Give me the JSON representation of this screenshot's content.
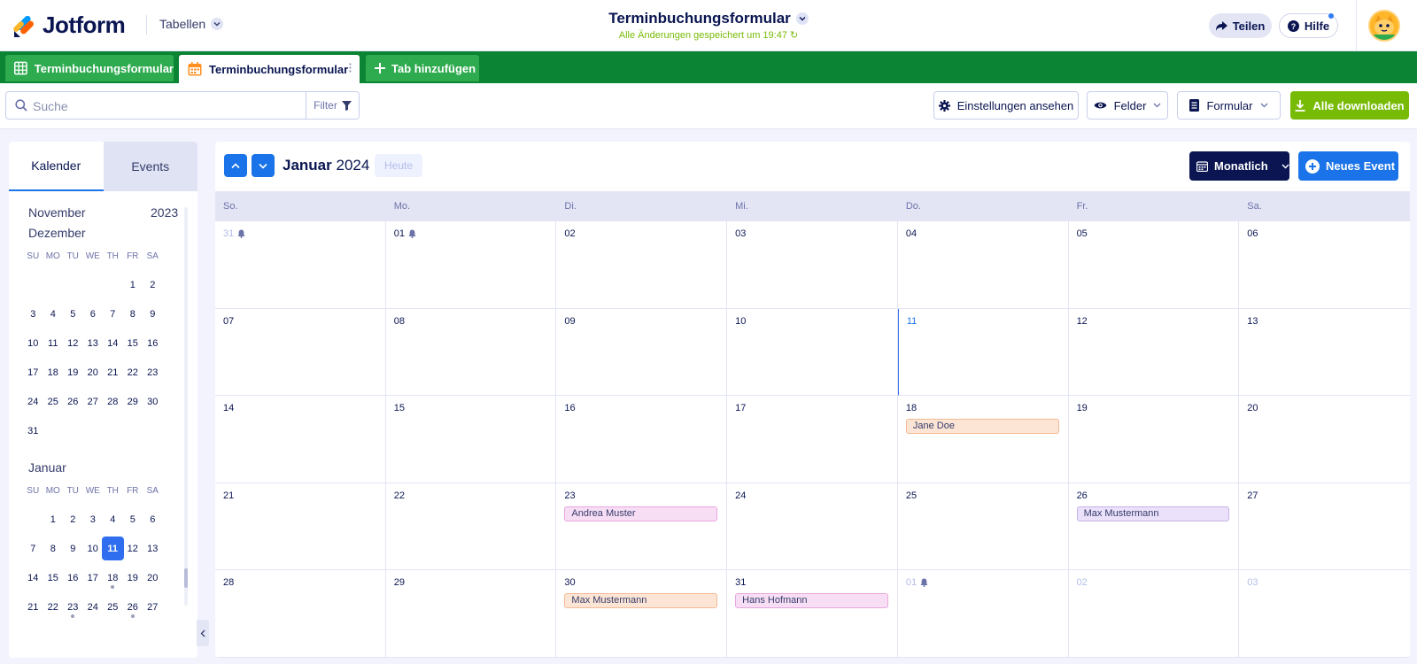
{
  "app": {
    "logo_text": "Jotform",
    "tables_menu": "Tabellen"
  },
  "header": {
    "title": "Terminbuchungsformular",
    "saved_status": "Alle Änderungen gespeichert um 19:47",
    "share_label": "Teilen",
    "help_label": "Hilfe"
  },
  "tabs": [
    {
      "label": "Terminbuchungsformular",
      "icon": "table-grid-icon"
    },
    {
      "label": "Terminbuchungsformular",
      "icon": "calendar-icon"
    },
    {
      "label": "Tab hinzufügen",
      "icon": "plus-icon"
    }
  ],
  "toolbar": {
    "search_placeholder": "Suche",
    "filter_label": "Filter",
    "settings_label": "Einstellungen ansehen",
    "fields_label": "Felder",
    "form_label": "Formular",
    "download_label": "Alle downloaden"
  },
  "sidebar": {
    "tab_calendar": "Kalender",
    "tab_events": "Events",
    "year_label": "2023",
    "months": [
      {
        "name": "November"
      },
      {
        "name": "Dezember",
        "dow": [
          "SU",
          "MO",
          "TU",
          "WE",
          "TH",
          "FR",
          "SA"
        ],
        "offset": 5,
        "days": 31
      },
      {
        "name": "Januar",
        "dow": [
          "SU",
          "MO",
          "TU",
          "WE",
          "TH",
          "FR",
          "SA"
        ],
        "offset": 1,
        "days": 27,
        "selected_day": 11,
        "event_days": [
          18,
          23,
          26
        ]
      }
    ]
  },
  "calendar": {
    "month": "Januar",
    "year": "2024",
    "today_label": "Heute",
    "view_label": "Monatlich",
    "new_event_label": "Neues Event",
    "weekdays": [
      "So.",
      "Mo.",
      "Di.",
      "Mi.",
      "Do.",
      "Fr.",
      "Sa."
    ],
    "weeks": [
      [
        {
          "d": "31",
          "muted": true,
          "bell": true
        },
        {
          "d": "01",
          "bell": true
        },
        {
          "d": "02"
        },
        {
          "d": "03"
        },
        {
          "d": "04"
        },
        {
          "d": "05"
        },
        {
          "d": "06"
        }
      ],
      [
        {
          "d": "07"
        },
        {
          "d": "08"
        },
        {
          "d": "09"
        },
        {
          "d": "10"
        },
        {
          "d": "11",
          "today": true
        },
        {
          "d": "12"
        },
        {
          "d": "13"
        }
      ],
      [
        {
          "d": "14"
        },
        {
          "d": "15"
        },
        {
          "d": "16"
        },
        {
          "d": "17"
        },
        {
          "d": "18",
          "event": "Jane Doe",
          "color": "orange"
        },
        {
          "d": "19"
        },
        {
          "d": "20"
        }
      ],
      [
        {
          "d": "21"
        },
        {
          "d": "22"
        },
        {
          "d": "23",
          "event": "Andrea Muster",
          "color": "pink"
        },
        {
          "d": "24"
        },
        {
          "d": "25"
        },
        {
          "d": "26",
          "event": "Max Mustermann",
          "color": "purple"
        },
        {
          "d": "27"
        }
      ],
      [
        {
          "d": "28"
        },
        {
          "d": "29"
        },
        {
          "d": "30",
          "event": "Max Mustermann",
          "color": "orange"
        },
        {
          "d": "31",
          "event": "Hans Hofmann",
          "color": "pink"
        },
        {
          "d": "01",
          "muted": true,
          "bell": true
        },
        {
          "d": "02",
          "muted": true
        },
        {
          "d": "03",
          "muted": true
        }
      ]
    ]
  },
  "colors": {
    "brand_green": "#0b8533",
    "accent_blue": "#1a73e8",
    "navy": "#0a1551",
    "download_green": "#78bb07"
  }
}
